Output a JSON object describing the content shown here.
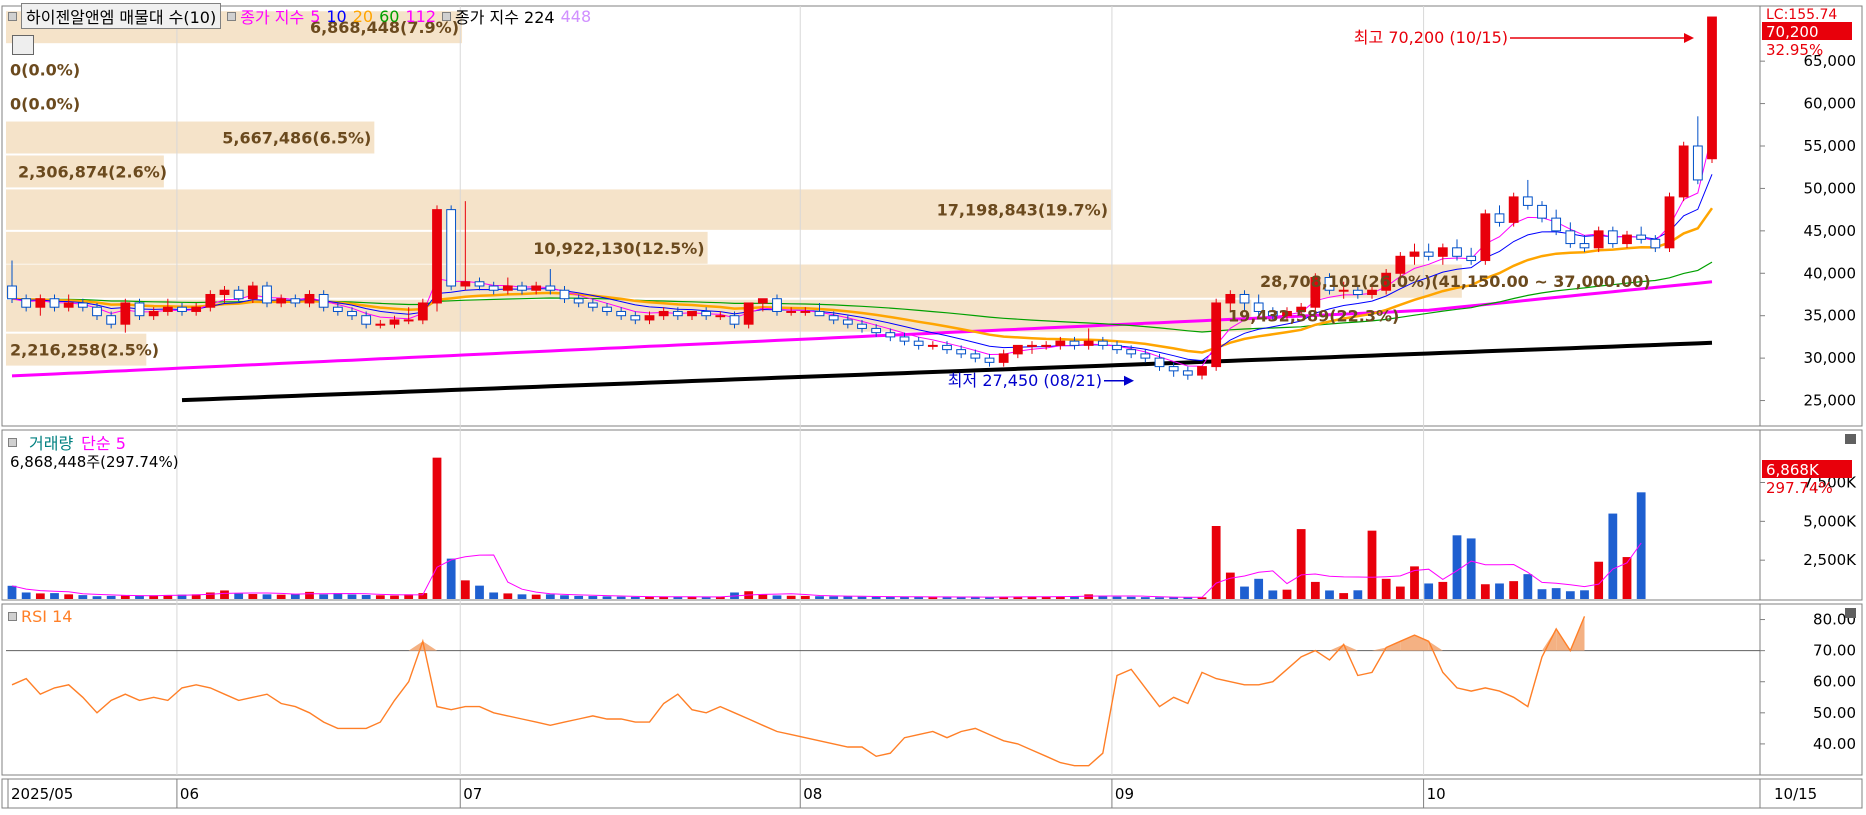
{
  "legend": {
    "indicator": "하이젠알앤엠 매물대 수(10)",
    "ma_label": "종가 지수",
    "ma_periods": [
      "5",
      "10",
      "20",
      "60",
      "112"
    ],
    "ma_colors": [
      "#ff00ff",
      "#0000ff",
      "#ffa500",
      "#00a000",
      "#ff00ff"
    ],
    "ma2_label": "종가 지수 224",
    "ma2_extra": "448"
  },
  "volume_panel": {
    "label": "거래량",
    "ma_label": "단순 5",
    "current": "6,868,448주(297.74%)",
    "current_box": "6,868K",
    "current_pct": "297.74%",
    "axis_ticks": [
      "7,500K",
      "5,000K",
      "2,500K"
    ]
  },
  "rsi_panel": {
    "label": "RSI 14",
    "axis_ticks": [
      "80.00",
      "70.00",
      "60.00",
      "50.00",
      "40.00"
    ]
  },
  "price_panel": {
    "axis_ticks": [
      "65,000",
      "60,000",
      "55,000",
      "50,000",
      "45,000",
      "40,000",
      "35,000",
      "30,000",
      "25,000"
    ],
    "current_box": "70,200",
    "current_pct": "32.95%",
    "lc_label": "LC:155.74",
    "high_label": "최고 70,200 (10/15)",
    "low_label": "최저 27,450 (08/21)",
    "range_label": "28,708,101(26.0%)(41,150.00 ~ 37,000.00)",
    "profile_labels": [
      "6,868,448(7.9%)",
      "0(0.0%)",
      "0(0.0%)",
      "5,667,486(6.5%)",
      "2,306,874(2.6%)",
      "17,198,843(19.7%)",
      "10,922,130(12.5%)",
      "28,708,101(26.0%)",
      "19,432,589(22.3%)",
      "2,216,258(2.5%)"
    ]
  },
  "x_axis": {
    "labels": [
      "2025/05",
      "06",
      "07",
      "08",
      "09",
      "10"
    ],
    "last_date": "10/15"
  },
  "chart_data": {
    "type": "candlestick",
    "price_candles": [
      [
        38500,
        41500,
        36500,
        37000
      ],
      [
        37000,
        37500,
        35500,
        36000
      ],
      [
        36000,
        37500,
        35000,
        37000
      ],
      [
        37000,
        37500,
        35500,
        36000
      ],
      [
        36000,
        37500,
        35500,
        36500
      ],
      [
        36500,
        37000,
        35500,
        36000
      ],
      [
        36000,
        36500,
        34500,
        35000
      ],
      [
        35000,
        35500,
        33500,
        34000
      ],
      [
        34000,
        37000,
        33000,
        36500
      ],
      [
        36500,
        37000,
        34500,
        35000
      ],
      [
        35000,
        36000,
        34500,
        35500
      ],
      [
        35500,
        37000,
        35000,
        36000
      ],
      [
        36000,
        36500,
        35000,
        35500
      ],
      [
        35500,
        36500,
        35000,
        36000
      ],
      [
        36000,
        38000,
        35500,
        37500
      ],
      [
        37500,
        38500,
        36500,
        38000
      ],
      [
        38000,
        38500,
        36500,
        37000
      ],
      [
        37000,
        39000,
        36500,
        38500
      ],
      [
        38500,
        39000,
        36000,
        36500
      ],
      [
        36500,
        37500,
        36000,
        37000
      ],
      [
        37000,
        37500,
        36000,
        36500
      ],
      [
        36500,
        38000,
        36000,
        37500
      ],
      [
        37500,
        38000,
        35500,
        36000
      ],
      [
        36000,
        36500,
        35000,
        35500
      ],
      [
        35500,
        36000,
        34500,
        35000
      ],
      [
        35000,
        35500,
        33500,
        34000
      ],
      [
        34000,
        34500,
        33500,
        34000
      ],
      [
        34000,
        35000,
        33500,
        34500
      ],
      [
        34500,
        36000,
        34000,
        34500
      ],
      [
        34500,
        37000,
        34000,
        36500
      ],
      [
        36500,
        48000,
        35500,
        47500
      ],
      [
        47500,
        48000,
        38000,
        38500
      ],
      [
        38500,
        48500,
        38000,
        39000
      ],
      [
        39000,
        39500,
        38000,
        38500
      ],
      [
        38500,
        39000,
        37500,
        38000
      ],
      [
        38000,
        39500,
        37500,
        38500
      ],
      [
        38500,
        39000,
        37500,
        38000
      ],
      [
        38000,
        39000,
        37500,
        38500
      ],
      [
        38500,
        40500,
        37500,
        38000
      ],
      [
        38000,
        38500,
        36500,
        37000
      ],
      [
        37000,
        37500,
        36000,
        36500
      ],
      [
        36500,
        37000,
        35500,
        36000
      ],
      [
        36000,
        36500,
        35000,
        35500
      ],
      [
        35500,
        36000,
        34500,
        35000
      ],
      [
        35000,
        35500,
        34000,
        34500
      ],
      [
        34500,
        35500,
        34000,
        35000
      ],
      [
        35000,
        36000,
        34500,
        35500
      ],
      [
        35500,
        36000,
        34500,
        35000
      ],
      [
        35000,
        35500,
        34500,
        35500
      ],
      [
        35500,
        36000,
        34500,
        35000
      ],
      [
        35000,
        35500,
        34500,
        35000
      ],
      [
        35000,
        35500,
        33500,
        34000
      ],
      [
        34000,
        36500,
        33500,
        36500
      ],
      [
        36500,
        37000,
        35500,
        37000
      ],
      [
        37000,
        37500,
        35000,
        35500
      ],
      [
        35500,
        36000,
        35000,
        35500
      ],
      [
        35500,
        36000,
        35000,
        35500
      ],
      [
        35500,
        36500,
        35000,
        35000
      ],
      [
        35000,
        35500,
        34000,
        34500
      ],
      [
        34500,
        35000,
        33500,
        34000
      ],
      [
        34000,
        34500,
        33000,
        33500
      ],
      [
        33500,
        34000,
        32500,
        33000
      ],
      [
        33000,
        33500,
        32000,
        32500
      ],
      [
        32500,
        33000,
        31500,
        32000
      ],
      [
        32000,
        32500,
        31000,
        31500
      ],
      [
        31500,
        32000,
        31000,
        31500
      ],
      [
        31500,
        32000,
        30500,
        31000
      ],
      [
        31000,
        31500,
        30000,
        30500
      ],
      [
        30500,
        31000,
        29500,
        30000
      ],
      [
        30000,
        30500,
        29000,
        29500
      ],
      [
        29500,
        31000,
        29000,
        30500
      ],
      [
        30500,
        31500,
        30000,
        31500
      ],
      [
        31500,
        32000,
        30500,
        31500
      ],
      [
        31500,
        32000,
        31000,
        31500
      ],
      [
        31500,
        32500,
        31000,
        32000
      ],
      [
        32000,
        32500,
        31000,
        31500
      ],
      [
        31500,
        33500,
        31000,
        32000
      ],
      [
        32000,
        32500,
        31000,
        31500
      ],
      [
        31500,
        32000,
        30500,
        31000
      ],
      [
        31000,
        31500,
        30000,
        30500
      ],
      [
        30500,
        31000,
        29500,
        30000
      ],
      [
        30000,
        30500,
        28500,
        29000
      ],
      [
        29000,
        29500,
        27800,
        28500
      ],
      [
        28500,
        29000,
        27450,
        28000
      ],
      [
        28000,
        29000,
        27500,
        29000
      ],
      [
        29000,
        37000,
        28500,
        36500
      ],
      [
        36500,
        38000,
        35500,
        37500
      ],
      [
        37500,
        38000,
        35500,
        36500
      ],
      [
        36500,
        37500,
        35000,
        35500
      ],
      [
        35500,
        36000,
        34500,
        35000
      ],
      [
        35000,
        36000,
        34500,
        35500
      ],
      [
        35500,
        36500,
        35000,
        36000
      ],
      [
        36000,
        40000,
        35500,
        39500
      ],
      [
        39500,
        40000,
        37500,
        38000
      ],
      [
        38000,
        39000,
        37000,
        38000
      ],
      [
        38000,
        38500,
        37000,
        37500
      ],
      [
        37500,
        38500,
        37000,
        38000
      ],
      [
        38000,
        40500,
        37500,
        40000
      ],
      [
        40000,
        42500,
        39500,
        42000
      ],
      [
        42000,
        43500,
        41000,
        42500
      ],
      [
        42500,
        43500,
        41500,
        42000
      ],
      [
        42000,
        43500,
        41000,
        43000
      ],
      [
        43000,
        44000,
        41500,
        42000
      ],
      [
        42000,
        43000,
        41000,
        41500
      ],
      [
        41500,
        47500,
        41000,
        47000
      ],
      [
        47000,
        48000,
        45500,
        46000
      ],
      [
        46000,
        49500,
        45500,
        49000
      ],
      [
        49000,
        51000,
        47500,
        48000
      ],
      [
        48000,
        48500,
        46000,
        46500
      ],
      [
        46500,
        47500,
        44500,
        45000
      ],
      [
        45000,
        46000,
        43000,
        43500
      ],
      [
        43500,
        44500,
        42500,
        43000
      ],
      [
        43000,
        45500,
        42500,
        45000
      ],
      [
        45000,
        45500,
        43000,
        43500
      ],
      [
        43500,
        45000,
        43000,
        44500
      ],
      [
        44500,
        45500,
        43500,
        44000
      ],
      [
        44000,
        44500,
        42500,
        43000
      ],
      [
        43000,
        49500,
        42500,
        49000
      ],
      [
        49000,
        55500,
        48500,
        55000
      ],
      [
        55000,
        58500,
        50500,
        51000
      ],
      [
        53500,
        70200,
        53000,
        70200
      ]
    ],
    "volume": [
      850,
      420,
      360,
      380,
      300,
      250,
      180,
      200,
      220,
      230,
      240,
      260,
      280,
      300,
      420,
      550,
      350,
      320,
      300,
      280,
      330,
      460,
      300,
      380,
      290,
      260,
      240,
      220,
      300,
      380,
      9100,
      2600,
      1200,
      860,
      420,
      360,
      300,
      280,
      300,
      240,
      200,
      190,
      170,
      150,
      140,
      130,
      150,
      160,
      130,
      120,
      130,
      420,
      500,
      300,
      230,
      210,
      200,
      180,
      170,
      160,
      150,
      140,
      150,
      130,
      140,
      120,
      120,
      120,
      130,
      120,
      140,
      160,
      160,
      150,
      160,
      170,
      300,
      200,
      150,
      140,
      120,
      110,
      100,
      100,
      110,
      4700,
      1700,
      800,
      1300,
      550,
      600,
      4500,
      1100,
      550,
      380,
      560,
      4400,
      1300,
      800,
      2100,
      1000,
      1100,
      4100,
      3900,
      950,
      1000,
      1150,
      1600,
      630,
      700,
      500,
      560,
      2400,
      5500,
      2700,
      6868
    ],
    "rsi": [
      59,
      61,
      56,
      58,
      59,
      55,
      50,
      54,
      56,
      54,
      55,
      54,
      58,
      59,
      58,
      56,
      54,
      55,
      56,
      53,
      52,
      50,
      47,
      45,
      45,
      45,
      47,
      54,
      60,
      73,
      52,
      51,
      52,
      52,
      50,
      49,
      48,
      47,
      46,
      47,
      48,
      49,
      48,
      48,
      47,
      47,
      53,
      56,
      51,
      50,
      52,
      50,
      48,
      46,
      44,
      43,
      42,
      41,
      40,
      39,
      39,
      36,
      37,
      42,
      43,
      44,
      42,
      44,
      45,
      43,
      41,
      40,
      38,
      36,
      34,
      33,
      33,
      37,
      62,
      64,
      58,
      52,
      55,
      53,
      63,
      61,
      60,
      59,
      59,
      60,
      64,
      68,
      70,
      67,
      72,
      62,
      63,
      71,
      73,
      75,
      73,
      63,
      58,
      57,
      58,
      57,
      55,
      52,
      68,
      77,
      70,
      81
    ],
    "rsi_levels": [
      70
    ]
  }
}
